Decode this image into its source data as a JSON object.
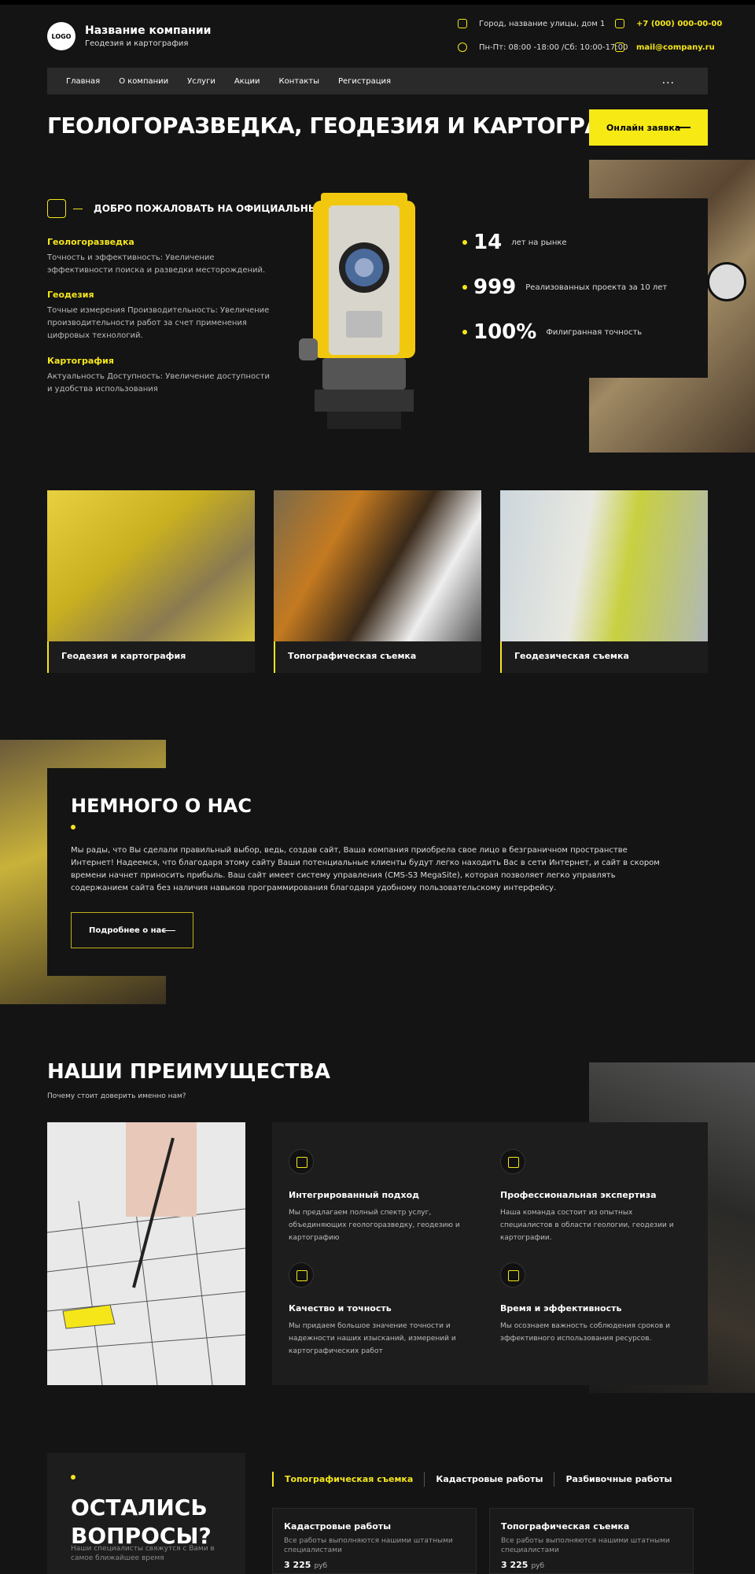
{
  "header": {
    "logo": "LOGO",
    "company_name": "Название компании",
    "company_sub": "Геодезия и картография",
    "address": "Город, название улицы, дом 1",
    "hours": "Пн-Пт: 08:00 -18:00 /Сб: 10:00-17:00",
    "phone": "+7 (000) 000-00-00",
    "email": "mail@company.ru"
  },
  "nav": {
    "items": [
      "Главная",
      "О компании",
      "Услуги",
      "Акции",
      "Контакты",
      "Регистрация"
    ],
    "more": "..."
  },
  "hero": {
    "title": "ГЕОЛОГОРАЗВЕДКА, ГЕОДЕЗИЯ И КАРТОГРАФИЯ",
    "cta": "Онлайн заявка",
    "welcome": "ДОБРО ПОЖАЛОВАТЬ НА ОФИЦИАЛЬНЫЙ САЙТ",
    "features": [
      {
        "title": "Геологоразведка",
        "text": "Точность и эффективность: Увеличение эффективности поиска и разведки месторождений."
      },
      {
        "title": "Геодезия",
        "text": "Точные измерения Производительность: Увеличение производительности работ за счет применения цифровых технологий."
      },
      {
        "title": "Картография",
        "text": "Актуальность Доступность: Увеличение доступности и удобства использования"
      }
    ],
    "stats": [
      {
        "value": "14",
        "label": "лет на рынке"
      },
      {
        "value": "999",
        "label": "Реализованных проекта за 10 лет"
      },
      {
        "value": "100%",
        "label": "Филигранная точность"
      }
    ]
  },
  "cards": [
    {
      "title": "Геодезия и картография"
    },
    {
      "title": "Топографическая съемка"
    },
    {
      "title": "Геодезическая съемка"
    }
  ],
  "about": {
    "title": "НЕМНОГО О НАС",
    "text": "Мы рады, что Вы сделали правильный выбор, ведь, создав сайт, Ваша компания приобрела свое лицо в безграничном пространстве Интернет! Надеемся, что благодаря этому сайту Ваши потенциальные клиенты будут легко находить Вас в сети Интернет, и сайт в скором времени начнет приносить прибыль. Ваш сайт имеет систему управления (CMS-S3 MegaSite), которая позволяет легко управлять содержанием сайта без наличия навыков программирования благодаря удобному пользовательскому интерфейсу.",
    "button": "Подробнее  о нас"
  },
  "advantages": {
    "title": "НАШИ ПРЕИМУЩЕСТВА",
    "subtitle": "Почему стоит доверить именно нам?",
    "items": [
      {
        "title": "Интегрированный подход",
        "text": "Мы предлагаем полный спектр услуг, объединяющих геологоразведку, геодезию и картографию"
      },
      {
        "title": "Профессиональная экспертиза",
        "text": "Наша команда состоит из опытных специалистов в области геологии, геодезии и картографии."
      },
      {
        "title": "Качество и точность",
        "text": "Мы придаем большое значение точности и надежности наших изысканий, измерений и картографических работ"
      },
      {
        "title": "Время и эффективность",
        "text": "Мы осознаем важность соблюдения сроков и эффективного использования ресурсов."
      }
    ]
  },
  "questions": {
    "title": "ОСТАЛИСЬ ВОПРОСЫ?",
    "text": "Наши специалисты свяжутся с Вами в самое ближайшее время"
  },
  "tabs": [
    "Топографическая съемка",
    "Кадастровые работы",
    "Разбивочные работы"
  ],
  "services": [
    {
      "title": "Кадастровые работы",
      "text": "Все работы выполняются нашими штатными специалистами",
      "price": "3 225",
      "unit": "руб"
    },
    {
      "title": "Топографическая съемка",
      "text": "Все работы выполняются нашими штатными специалистами",
      "price": "3 225",
      "unit": "руб"
    }
  ],
  "colors": {
    "accent": "#f7ea14",
    "bg": "#141414",
    "panel": "#1d1d1d"
  }
}
